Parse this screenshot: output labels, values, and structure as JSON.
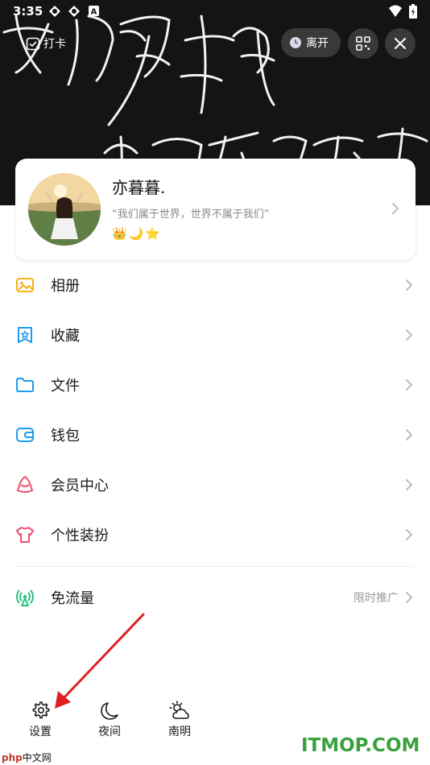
{
  "status_bar": {
    "time": "3:35",
    "icons": [
      "notification-icon",
      "notification-icon",
      "a-icon",
      "wifi-icon",
      "battery-icon"
    ]
  },
  "header": {
    "background_handwriting": "我们属于世界 世界不属于我们",
    "checkin_label": "打卡",
    "away_label": "离开"
  },
  "profile": {
    "name": "亦暮暮.",
    "signature": "“我们属于世界，世界不属于我们”",
    "badges": [
      "👑",
      "🌙",
      "⭐"
    ]
  },
  "menu": {
    "items": [
      {
        "label": "相册",
        "icon": "album-icon",
        "color": "#f5b417"
      },
      {
        "label": "收藏",
        "icon": "favorites-icon",
        "color": "#1f9bf0"
      },
      {
        "label": "文件",
        "icon": "folder-icon",
        "color": "#1f9bf0"
      },
      {
        "label": "钱包",
        "icon": "wallet-icon",
        "color": "#1f9bf0"
      },
      {
        "label": "会员中心",
        "icon": "vip-icon",
        "color": "#f0506e"
      },
      {
        "label": "个性装扮",
        "icon": "dress-up-icon",
        "color": "#f0506e"
      }
    ],
    "free_data": {
      "label": "免流量",
      "extra": "限时推广",
      "icon": "signal-icon",
      "color": "#2ac07a"
    }
  },
  "bottom_bar": {
    "settings": "设置",
    "night": "夜间",
    "weather": "南明"
  },
  "watermarks": {
    "left_brand": "php",
    "left_text": "中文网",
    "right": "ITMOP.COM"
  }
}
